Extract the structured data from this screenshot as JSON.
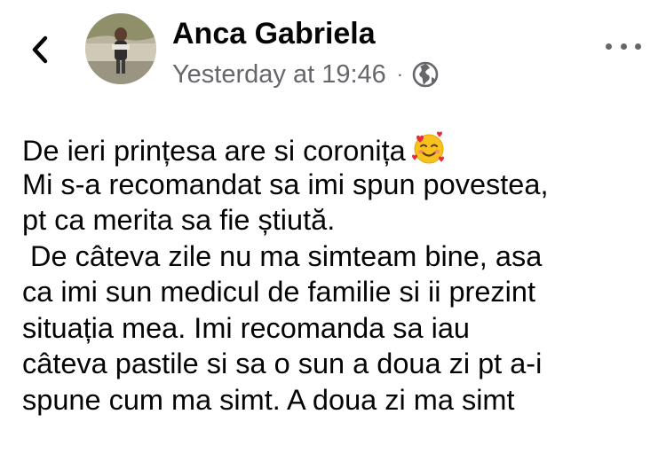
{
  "header": {
    "author_name": "Anca Gabriela",
    "timestamp": "Yesterday at 19:46",
    "separator": "·",
    "back_icon": "chevron-left-icon",
    "privacy_icon": "globe-icon",
    "more_icon": "more-horizontal-icon"
  },
  "post": {
    "lines": [
      "De ieri prințesa are si coronița",
      "Mi s-a recomandat sa imi spun povestea,",
      "pt ca merita sa fie știută.",
      " De câteva zile nu ma simteam bine, asa",
      "ca imi sun medicul de familie si ii prezint",
      "situația mea. Imi recomanda sa iau",
      "câteva pastile si sa o sun a doua zi pt a-i",
      "spune cum ma simt. A doua zi ma simt"
    ],
    "emoji": "smiling-face-with-hearts"
  },
  "colors": {
    "text": "#050505",
    "secondary_text": "#65676b",
    "background": "#ffffff"
  }
}
